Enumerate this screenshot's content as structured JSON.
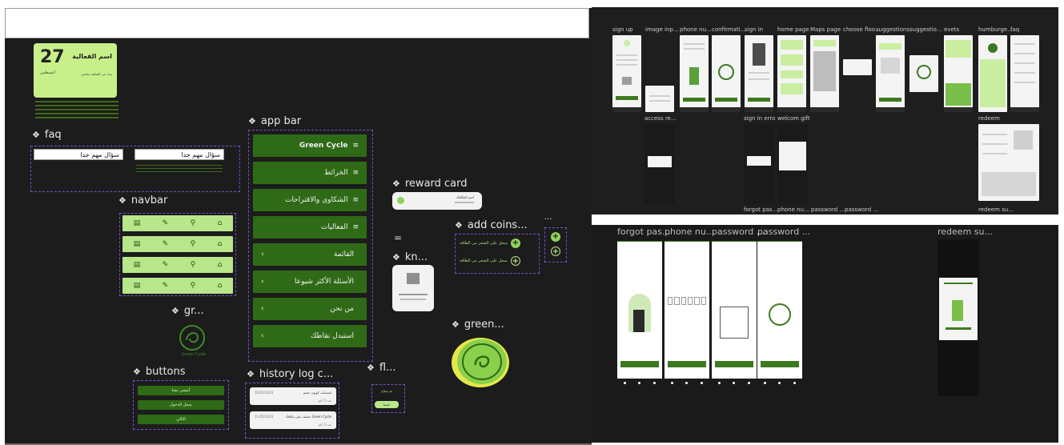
{
  "left_canvas": {
    "event_card": {
      "day": "27",
      "title": "اسم الفعالية",
      "month": "أغسطس",
      "description": "نبذة عن الفعالية ملخص"
    },
    "faq": {
      "title": "faq",
      "question_1": "سؤال مهم جدا",
      "question_2": "سؤال مهم جدا"
    },
    "navbar": {
      "title": "navbar",
      "icons": [
        "home-icon",
        "location-icon",
        "edit-icon",
        "image-icon"
      ]
    },
    "app_bar": {
      "title": "app bar",
      "items": [
        "Green Cycle",
        "الخرائط",
        "الشكاوى والاقتراحات",
        "الفعاليات",
        "القائمة",
        "الأسئلة الأكثر شيوعا",
        "من نحن",
        "استبدل نقاطك"
      ]
    },
    "reward_card": {
      "title": "reward card",
      "text": "اسم المكافأة"
    },
    "add_coins": {
      "title": "add coins...",
      "row_1": "سجل على الشجر من الطاقة",
      "row_2": "سجل على الشجر من الطاقة",
      "more": "..."
    },
    "equals": "=",
    "kn": {
      "title": "kn..."
    },
    "gr": {
      "title": "gr...",
      "caption": "Green Cycle"
    },
    "green": {
      "title": "green..."
    },
    "buttons": {
      "title": "buttons",
      "labels": [
        "أمشي معنا",
        "سجل الدخول",
        "التالي"
      ]
    },
    "history_log": {
      "title": "history log c...",
      "cards": [
        {
          "main": "استبدلت كوبون خصم",
          "date": "10/05/2024",
          "meta": "منذ 5 أيام"
        },
        {
          "main": "حصلت على مكافأة Green Cycle",
          "date": "11/05/2024",
          "meta": "منذ 3 أيام"
        }
      ]
    },
    "fl": {
      "title": "fl...",
      "text": "تم بنجاح",
      "button": "حسنا"
    }
  },
  "right_top": {
    "labels_row1": [
      "sign up",
      "image inp...",
      "phone nu...",
      "confirmati...",
      "sign in",
      "home page",
      "Maps page",
      "choose floo...",
      "suggestions",
      "suggestio...",
      "evets",
      "humburge...",
      "faq"
    ],
    "labels_row2": [
      "access re...",
      "sign in erro",
      "welcom gift",
      "redeem"
    ],
    "labels_row3": [
      "forgot pas...",
      "phone nu...",
      "password ...",
      "password ...",
      "redeem su..."
    ]
  },
  "right_bottom": {
    "labels": [
      "forgot pas...",
      "phone nu...",
      "password ...",
      "password ...",
      "redeem su..."
    ]
  },
  "colors": {
    "dark_green": "#2f6a17",
    "light_green": "#b8e68a",
    "canvas": "#1c1c1c"
  }
}
